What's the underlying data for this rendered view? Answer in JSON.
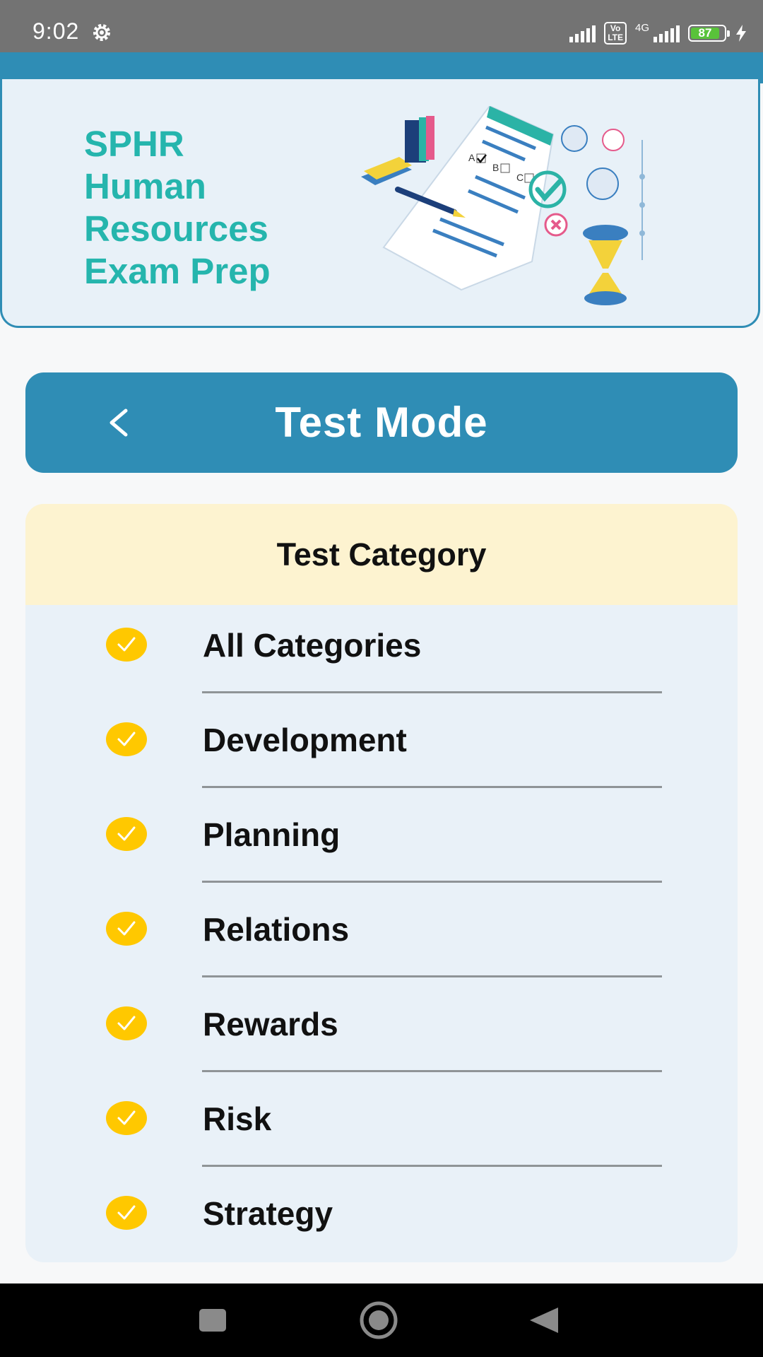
{
  "status_bar": {
    "time": "9:02",
    "battery_level": "87",
    "network_label": "4G",
    "volte_label": "Vo\nLTE",
    "icons": [
      "settings-gear-icon",
      "signal-icon",
      "volte-icon",
      "signal-4g-icon",
      "battery-icon",
      "charging-bolt-icon"
    ]
  },
  "banner": {
    "title_lines": [
      "SPHR",
      "Human",
      "Resources",
      "Exam Prep"
    ],
    "title_color": "#25b5ad",
    "art_answer_letters": [
      "A",
      "B",
      "C"
    ]
  },
  "header": {
    "back_icon": "chevron-left-icon",
    "title": "Test Mode",
    "color": "#2f8db5"
  },
  "categories": {
    "heading": "Test Category",
    "check_color": "#ffc800",
    "items": [
      {
        "label": "All Categories",
        "checked": true
      },
      {
        "label": "Development",
        "checked": true
      },
      {
        "label": "Planning",
        "checked": true
      },
      {
        "label": "Relations",
        "checked": true
      },
      {
        "label": "Rewards",
        "checked": true
      },
      {
        "label": "Risk",
        "checked": true
      },
      {
        "label": "Strategy",
        "checked": true
      }
    ]
  },
  "nav_bar": {
    "buttons": [
      "recents-square-icon",
      "home-circle-icon",
      "back-triangle-icon"
    ]
  }
}
